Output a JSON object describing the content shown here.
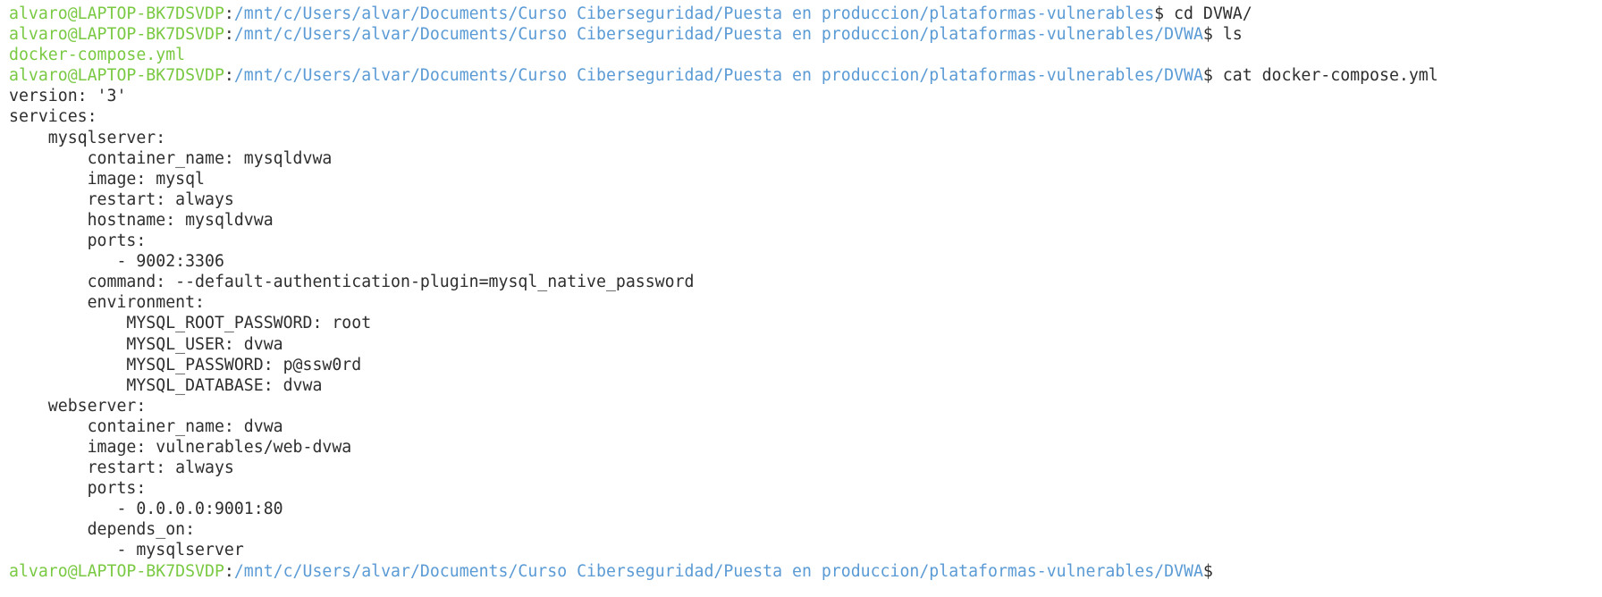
{
  "prompt": {
    "user_host": "alvaro@LAPTOP-BK7DSVDP",
    "separator": ":",
    "path_base": "/mnt/c/Users/alvar/Documents/Curso Ciberseguridad/Puesta en produccion/plataformas-vulnerables",
    "path_dvwa": "/mnt/c/Users/alvar/Documents/Curso Ciberseguridad/Puesta en produccion/plataformas-vulnerables/DVWA",
    "dollar": "$"
  },
  "commands": {
    "cd": " cd DVWA/",
    "ls": " ls",
    "cat": " cat docker-compose.yml"
  },
  "ls_output": "docker-compose.yml",
  "file_lines": [
    "version: '3'",
    "services:",
    "    mysqlserver:",
    "        container_name: mysqldvwa",
    "        image: mysql",
    "        restart: always",
    "        hostname: mysqldvwa",
    "        ports:",
    "           - 9002:3306",
    "        command: --default-authentication-plugin=mysql_native_password",
    "        environment:",
    "            MYSQL_ROOT_PASSWORD: root",
    "            MYSQL_USER: dvwa",
    "            MYSQL_PASSWORD: p@ssw0rd",
    "            MYSQL_DATABASE: dvwa",
    "    webserver:",
    "        container_name: dvwa",
    "        image: vulnerables/web-dvwa",
    "        restart: always",
    "        ports:",
    "           - 0.0.0.0:9001:80",
    "        depends_on:",
    "           - mysqlserver"
  ],
  "colors": {
    "user_host": "#7ac943",
    "path": "#5b9bd5",
    "text": "#2e2e2e",
    "background": "#ffffff"
  }
}
